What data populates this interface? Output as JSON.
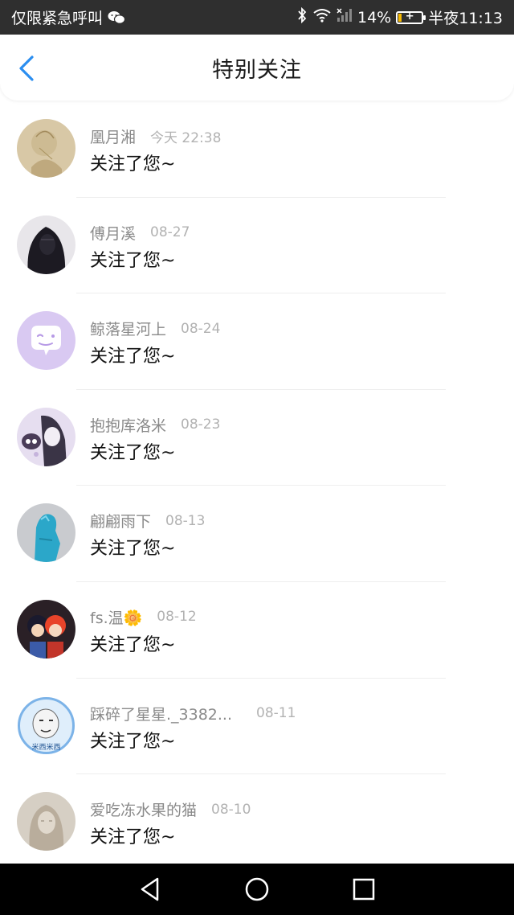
{
  "status_bar": {
    "carrier": "仅限紧急呼叫",
    "battery": "14%",
    "time": "半夜11:13"
  },
  "header": {
    "title": "特别关注"
  },
  "items": [
    {
      "name": "凰月湘",
      "time": "今天 22:38",
      "message": "关注了您~"
    },
    {
      "name": "傅月溪",
      "time": "08-27",
      "message": "关注了您~"
    },
    {
      "name": "鲸落星河上",
      "time": "08-24",
      "message": "关注了您~"
    },
    {
      "name": "抱抱库洛米",
      "time": "08-23",
      "message": "关注了您~"
    },
    {
      "name": "翩翩雨下",
      "time": "08-13",
      "message": "关注了您~"
    },
    {
      "name": "fs.温🌼",
      "time": "08-12",
      "message": "关注了您~"
    },
    {
      "name": "踩碎了星星._3382...",
      "time": "08-11",
      "message": "关注了您~"
    },
    {
      "name": "爱吃冻水果的猫",
      "time": "08-10",
      "message": "关注了您~"
    }
  ],
  "avatar_badge_text": "米西米西",
  "colors": {
    "accent": "#2b8ef0",
    "status_bar_bg": "#2f2f2f",
    "name_text": "#8a8a8a",
    "time_text": "#b2b2b2"
  }
}
